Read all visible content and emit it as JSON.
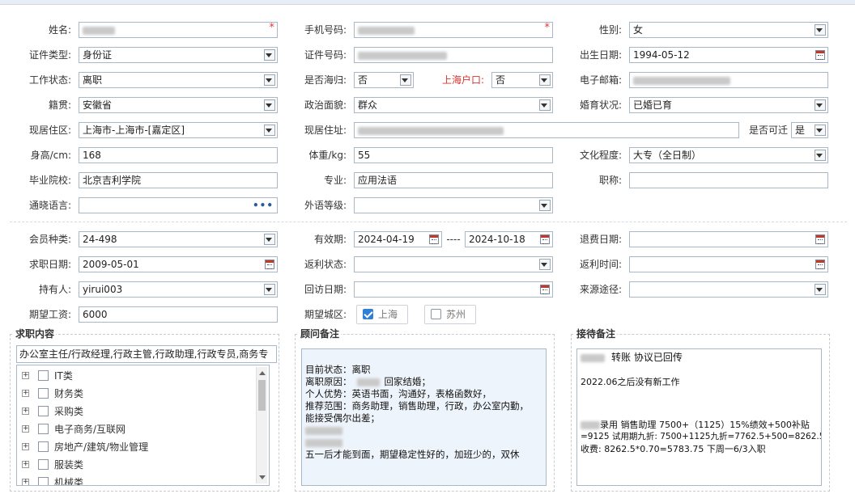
{
  "form": {
    "name_label": "姓名:",
    "phone_label": "手机号码:",
    "gender_label": "性别:",
    "gender_value": "女",
    "idtype_label": "证件类型:",
    "idtype_value": "身份证",
    "idnum_label": "证件号码:",
    "birth_label": "出生日期:",
    "birth_value": "1994-05-12",
    "workstatus_label": "工作状态:",
    "workstatus_value": "离职",
    "returnee_label": "是否海归:",
    "returnee_value": "否",
    "shanghai_hukou_label": "上海户口:",
    "shanghai_hukou_value": "否",
    "email_label": "电子邮箱:",
    "native_label": "籍贯:",
    "native_value": "安徽省",
    "political_label": "政治面貌:",
    "political_value": "群众",
    "marital_label": "婚育状况:",
    "marital_value": "已婚已育",
    "residence_label": "现居住区:",
    "residence_value": "上海市-上海市-[嘉定区]",
    "address_label": "现居住址:",
    "relocate_label": "是否可迁",
    "relocate_value": "是",
    "height_label": "身高/cm:",
    "height_value": "168",
    "weight_label": "体重/kg:",
    "weight_value": "55",
    "education_label": "文化程度:",
    "education_value": "大专（全日制）",
    "school_label": "毕业院校:",
    "school_value": "北京吉利学院",
    "major_label": "专业:",
    "major_value": "应用法语",
    "title_label": "职称:",
    "language_label": "通晓语言:",
    "language_dots": "•••",
    "foreign_level_label": "外语等级:"
  },
  "membership": {
    "type_label": "会员种类:",
    "type_value": "24-498",
    "valid_label": "有效期:",
    "valid_from": "2024-04-19",
    "valid_sep": "----",
    "valid_to": "2024-10-18",
    "refund_date_label": "退费日期:",
    "apply_date_label": "求职日期:",
    "apply_date_value": "2009-05-01",
    "rebate_status_label": "返利状态:",
    "rebate_time_label": "返利时间:",
    "holder_label": "持有人:",
    "holder_value": "yirui003",
    "visit_date_label": "回访日期:",
    "source_label": "来源途径:",
    "salary_label": "期望工资:",
    "salary_value": "6000",
    "city_label": "期望城区:",
    "cities": [
      {
        "label": "上海",
        "checked": true
      },
      {
        "label": "苏州",
        "checked": false
      }
    ]
  },
  "job": {
    "title": "求职内容",
    "summary": "办公室主任/行政经理,行政主管,行政助理,行政专员,商务专",
    "categories": [
      "IT类",
      "财务类",
      "采购类",
      "电子商务/互联网",
      "房地产/建筑/物业管理",
      "服装类",
      "机械类"
    ],
    "plus_glyph": "+"
  },
  "advisor": {
    "title": "顾问备注",
    "lines": [
      "目前状态：离职",
      "离职原因：",
      "回家结婚；",
      "个人优势：英语书面，沟通好，表格函数好，",
      "推荐范围：商务助理，销售助理，行政，办公室内勤，",
      "能接受偶尔出差；",
      "五一后才能到面，期望稳定性好的，加班少的，双休"
    ]
  },
  "reception": {
    "title": "接待备注",
    "lines": [
      "转账 协议已回传",
      "2022.06之后没有新工作",
      "录用 销售助理 7500+（1125）15%绩效+500补贴",
      "=9125 试用期九折: 7500+1125九折=7762.5+500=8262.5",
      "收费: 8262.5*0.70=5783.75 下周一6/3入职"
    ]
  }
}
